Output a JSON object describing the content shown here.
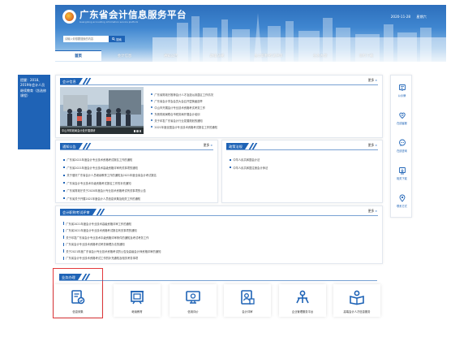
{
  "header": {
    "title": "广东省会计信息服务平台",
    "subtitle": "Guangdong accounting information service platform",
    "date": "2020-11-28",
    "weekday": "星期六",
    "search_placeholder": "请输入你想要搜索的内容",
    "search_button": "搜索"
  },
  "nav": {
    "items": [
      "首页",
      "会计信息",
      "通知公告",
      "政策法规",
      "会计职称考试评审",
      "业务办理",
      "资料下载"
    ]
  },
  "notice": {
    "text": "提醒：2018、2019年会计人员继续教育（含选修课程）"
  },
  "accounting_info": {
    "label": "会计信息",
    "more": "更多",
    "image_caption": "中山市财政局会计处开展调研",
    "items": [
      "广东省财政厅推荐会计人才及选派到县区工作情况",
      "广东省会计学会会员大会召开暨换届选举",
      "中山市开展会计专业技术资格考试考务工作",
      "东莞财政局联合市税务局开展会计培训",
      "关于印发广东省会计行业发展规划的通知",
      "2021年度全国会计专业技术资格考试报名工作的通知"
    ]
  },
  "notices": {
    "label": "通知公告",
    "more": "更多",
    "items": [
      "广东省2021年度会计专业技术资格考试报名工作的通知",
      "广东省2021年度会计专业技术高级资格评审有关事项的通知",
      "关于做好广东省会计人员继续教育工作的通知及2021年度全省会计考试报名",
      "广东省会计专业技术中级资格考试报名工作的补充通知",
      "广东省财政厅关于2020年度会计专业技术资格考试有关事项的公告",
      "广东省关于开展2021年度会计人员信息采集及相关工作的通知"
    ]
  },
  "policies": {
    "label": "政策法规",
    "more": "更多",
    "items": [
      "中华人民共和国会计法",
      "中华人民共和国注册会计师法"
    ]
  },
  "exam": {
    "label": "会计职称考试评审",
    "more": "更多",
    "items": [
      "广东省2021年度会计专业技术高级资格评审工作的通知",
      "广东省2021年度会计专业技术资格考试报名有关事项的通知",
      "关于印发广东省会计专业技术中级资格评审条件的通知及考试考务工作",
      "广东省会计专业技术资格考试考务管理办法的通知",
      "关于2021年度广东省会计专业技术资格考试的公告及高级会计师资格评审的通知",
      "广东省会计专业技术资格考试工作的补充通知及相关考务事项"
    ]
  },
  "quick_links": [
    {
      "label": "公示牌",
      "icon": "notice-icon"
    },
    {
      "label": "在线客服",
      "icon": "service-icon"
    },
    {
      "label": "在线咨询",
      "icon": "chat-icon"
    },
    {
      "label": "相关下载",
      "icon": "download-icon"
    },
    {
      "label": "联系方式",
      "icon": "location-icon"
    }
  ],
  "business": {
    "label": "业务办理",
    "items": [
      {
        "label": "信息采集",
        "icon": "info-collect-icon"
      },
      {
        "label": "继续教育",
        "icon": "education-icon"
      },
      {
        "label": "信用评价",
        "icon": "credit-icon"
      },
      {
        "label": "会计评审",
        "icon": "review-icon"
      },
      {
        "label": "企业管理服务平台",
        "icon": "enterprise-icon"
      },
      {
        "label": "高端会计人才信息服务",
        "icon": "talent-icon"
      }
    ]
  },
  "colors": {
    "primary": "#1e63b6",
    "highlight": "#e4393c"
  }
}
